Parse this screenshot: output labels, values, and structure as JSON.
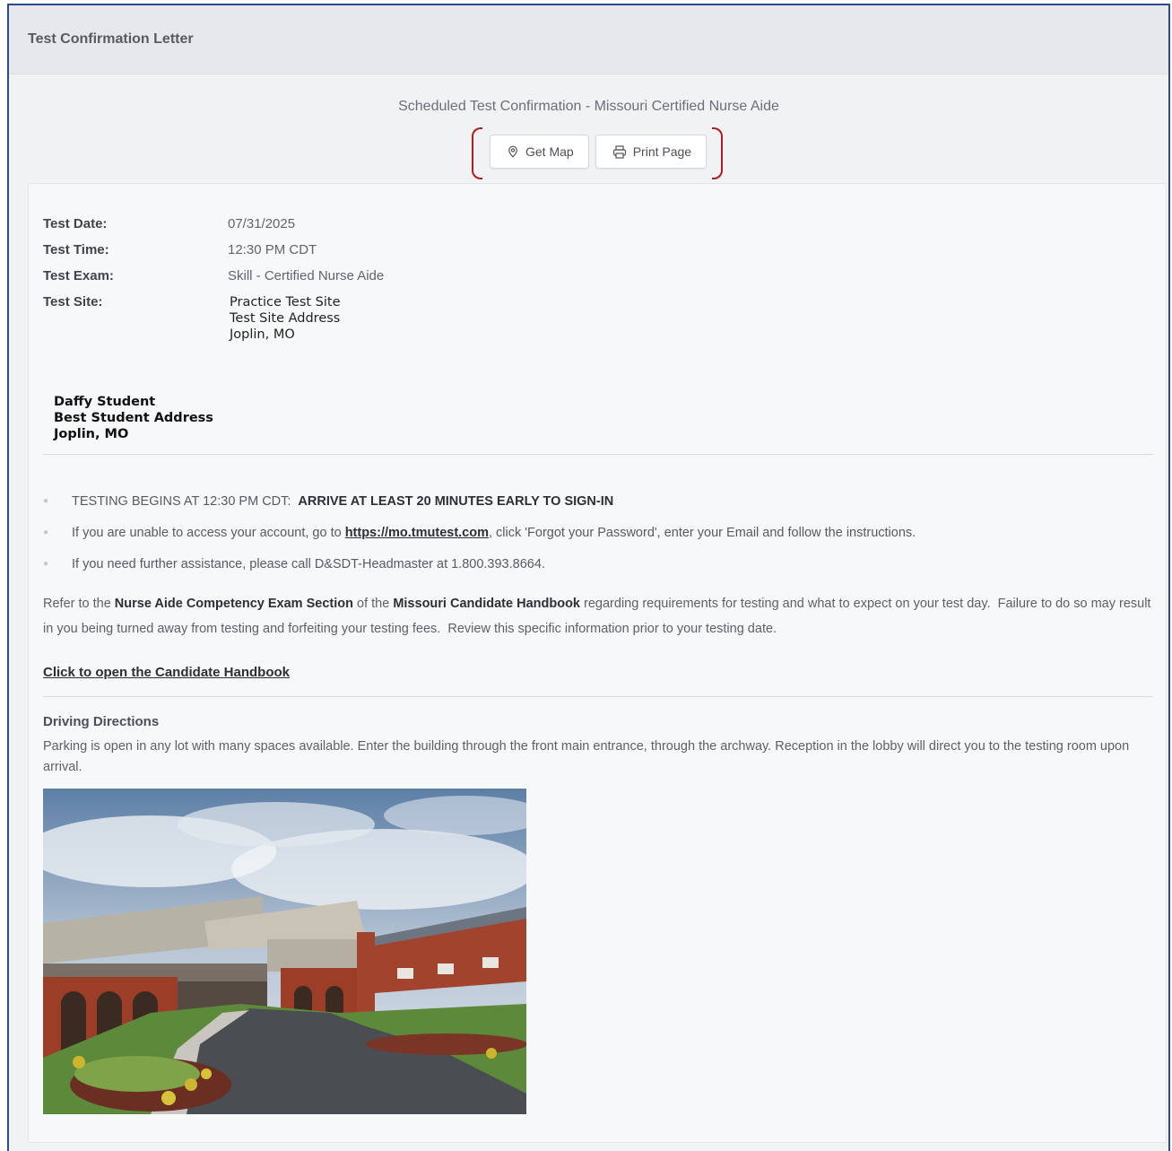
{
  "header": {
    "title": "Test Confirmation Letter"
  },
  "subheading": "Scheduled Test Confirmation - Missouri Certified Nurse Aide",
  "actions": {
    "get_map": "Get Map",
    "print_page": "Print Page"
  },
  "details": [
    {
      "label": "Test Date:",
      "value": "07/31/2025"
    },
    {
      "label": "Test Time:",
      "value": "12:30 PM CDT"
    },
    {
      "label": "Test Exam:",
      "value": "Skill - Certified Nurse Aide"
    }
  ],
  "site": {
    "label": "Test Site:",
    "lines": [
      "Practice Test Site",
      "Test Site Address",
      "Joplin, MO"
    ]
  },
  "student": {
    "lines": [
      "Daffy Student",
      "Best Student Address",
      "Joplin, MO"
    ]
  },
  "bullets": {
    "b1_text": "TESTING BEGINS AT 12:30 PM CDT:",
    "b1_bold": "ARRIVE AT LEAST 20 MINUTES EARLY TO SIGN-IN",
    "b2_pre": "If you are unable to access your account, go to ",
    "b2_link": "https://mo.tmutest.com",
    "b2_post": ", click 'Forgot your Password', enter your Email and follow the instructions.",
    "b3_text": "If you need further assistance, please call D&SDT-Headmaster at 1.800.393.8664."
  },
  "refer": {
    "pre": "Refer to the ",
    "section": "Nurse Aide Competency Exam Section",
    "mid": " of the ",
    "handbook": "Missouri Candidate Handbook",
    "post": " regarding requirements for testing and what to expect on your test day.  Failure to do so may result in you being turned away from testing and forfeiting your testing fees.  Review this specific information prior to your testing date."
  },
  "handbook_link": "Click to open the Candidate Handbook",
  "driving": {
    "title": "Driving Directions",
    "text": "Parking is open in any lot with many spaces available. Enter the building through the front main entrance, through the archway. Reception in the lobby will direct you to the testing room upon arrival."
  },
  "colors": {
    "frame_border": "#2e4a8f",
    "highlight_bracket": "#b01c1c",
    "card_bg": "#f7f8f9"
  }
}
